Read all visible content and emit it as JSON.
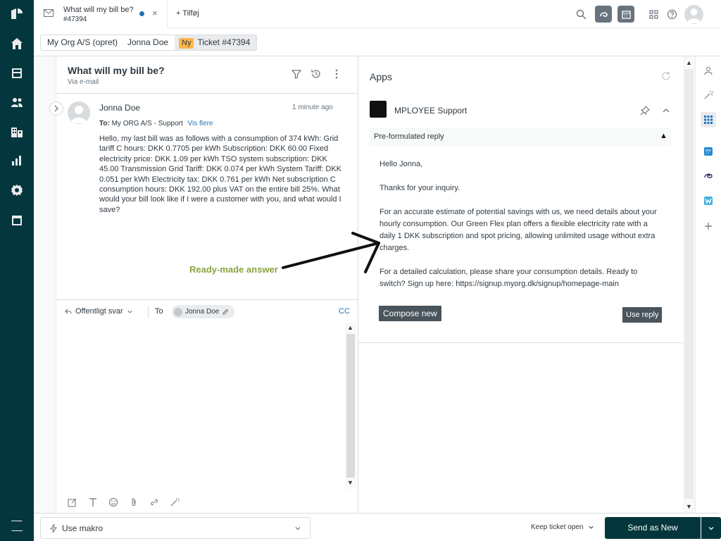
{
  "top_tab": {
    "title": "What will my bill be?",
    "ticket_number": "#47394",
    "add_label": "+ Tilføj"
  },
  "breadcrumb": {
    "org": "My Org A/S (opret)",
    "user": "Jonna Doe",
    "status_badge": "Ny",
    "ticket": "Ticket #47394"
  },
  "conversation": {
    "title": "What will my bill be?",
    "channel": "Via e-mail",
    "message": {
      "author": "Jonna Doe",
      "time": "1 minute ago",
      "to_label": "To:",
      "to_value": "My ORG A/S - Support",
      "show_more": "Vis flere",
      "body": "Hello, my last bill was as follows with a consumption of 374 kWh: Grid tariff C hours: DKK 0.7705 per kWh Subscription: DKK 60.00 Fixed electricity price: DKK 1.09 per kWh TSO system subscription: DKK 45.00 Transmission Grid Tariff: DKK 0.074 per kWh System Tariff: DKK 0.051 per kWh Electricity tax: DKK 0.761 per kWh Net subscription C consumption hours: DKK 192.00 plus VAT on the entire bill 25%. What would your bill look like if I were a customer with you, and what would I save?"
    },
    "annotation": "Ready-made answer"
  },
  "composer": {
    "reply_type": "Offentligt svar",
    "to_label": "To",
    "recipient": "Jonna Doe",
    "cc_label": "CC"
  },
  "apps_panel": {
    "title": "Apps",
    "app_name": "MPLOYEE Support",
    "section_label": "Pre-formulated reply",
    "reply_text": "Hello Jonna,\n\nThanks for your inquiry.\n\nFor an accurate estimate of potential savings with us, we need details about your hourly consumption. Our Green Flex plan offers a flexible electricity rate with a daily 1 DKK subscription and spot pricing, allowing unlimited usage without extra charges.\n\nFor a detailed calculation, please share your consumption details. Ready to switch? Sign up here: https://signup.myorg.dk/signup/homepage-main",
    "compose_button": "Compose new",
    "use_button": "Use reply"
  },
  "bottom_bar": {
    "macro_label": "Use makro",
    "keep_label": "Keep ticket open",
    "send_label": "Send as New"
  },
  "colors": {
    "nav_bg": "#03363d",
    "accent_blue": "#1f73b7",
    "badge_new": "#ffb648",
    "annotation_green": "#8aa23f",
    "dark_button": "#49545c"
  }
}
